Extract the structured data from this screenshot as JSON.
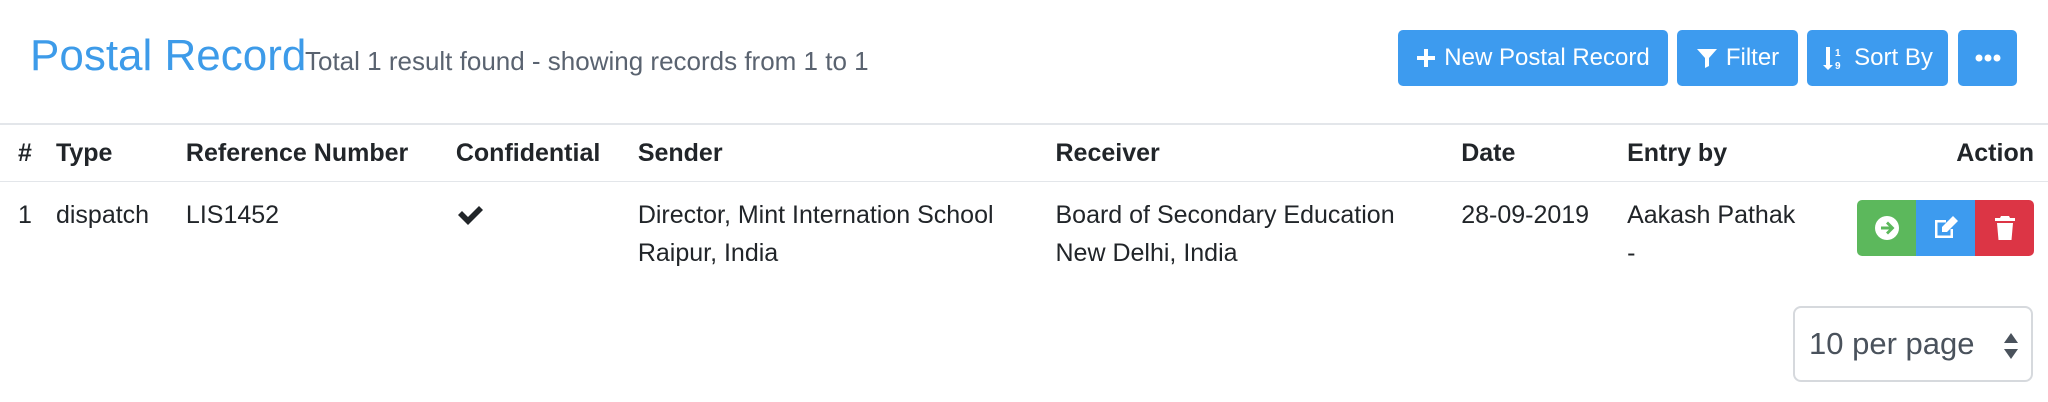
{
  "header": {
    "title": "Postal Record",
    "subtitle": "Total 1 result found - showing records from 1 to 1"
  },
  "toolbar": {
    "new_label": "New Postal Record",
    "filter_label": "Filter",
    "sort_label": "Sort By",
    "more_icon": "ellipsis-icon"
  },
  "table": {
    "columns": [
      "#",
      "Type",
      "Reference Number",
      "Confidential",
      "Sender",
      "Receiver",
      "Date",
      "Entry by",
      "Action"
    ],
    "rows": [
      {
        "num": "1",
        "type": "dispatch",
        "reference": "LIS1452",
        "confidential": true,
        "sender_line1": "Director, Mint Internation School",
        "sender_line2": "Raipur, India",
        "receiver_line1": "Board of Secondary Education",
        "receiver_line2": "New Delhi, India",
        "date": "28-09-2019",
        "entry_line1": "Aakash Pathak",
        "entry_line2": "-"
      }
    ]
  },
  "pagination": {
    "per_page": "10 per page"
  },
  "colors": {
    "primary": "#3d9bef",
    "title": "#3d9be9",
    "success": "#5cb85c",
    "danger": "#dc3545"
  }
}
